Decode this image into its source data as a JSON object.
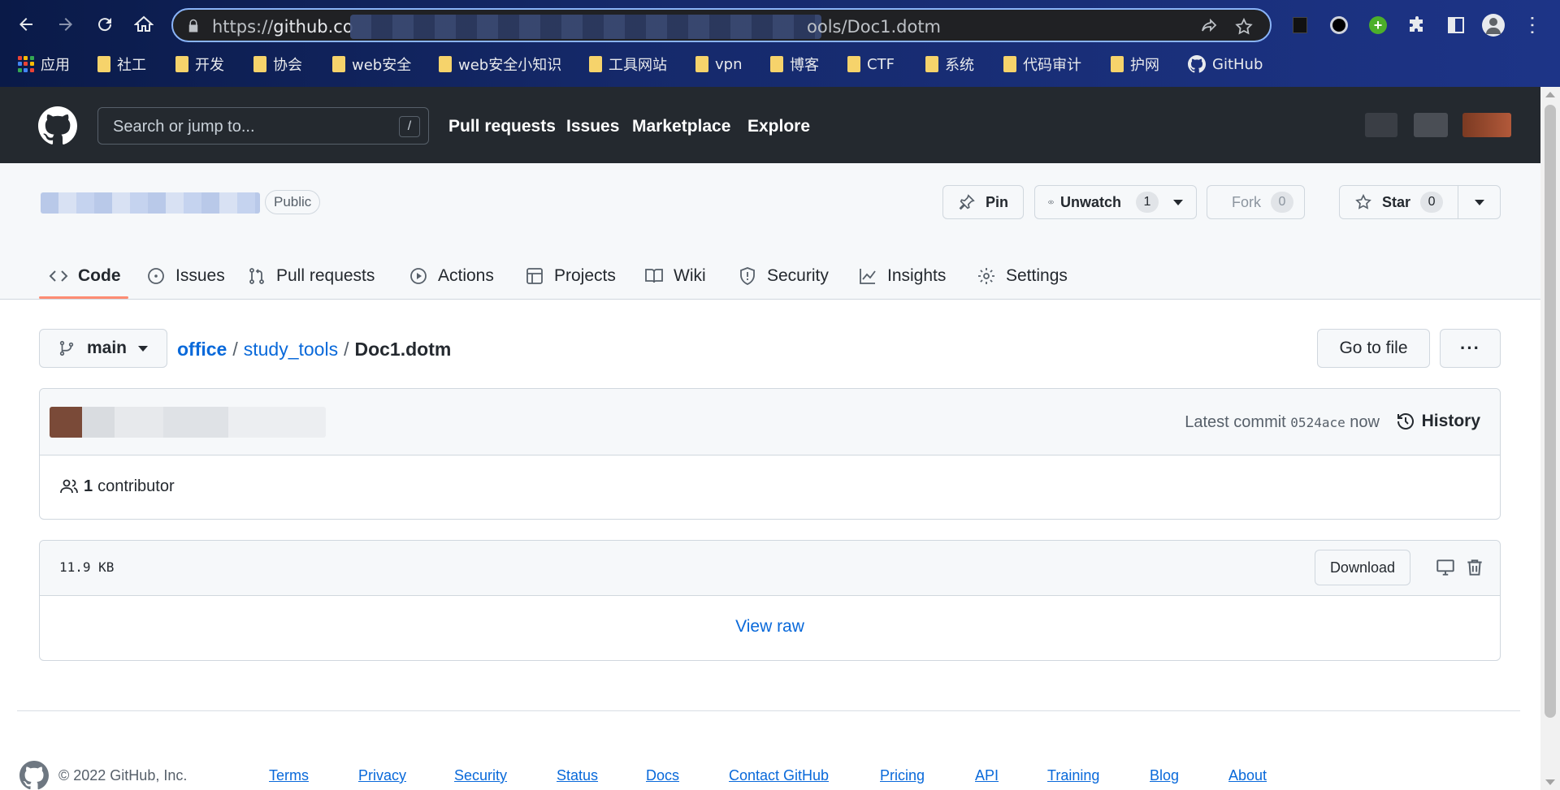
{
  "browser": {
    "url_prefix": "https://",
    "url_host": "github.co",
    "url_tail": "ools/Doc1.dotm",
    "bookmarks": [
      "应用",
      "社工",
      "开发",
      "协会",
      "web安全",
      "web安全小知识",
      "工具网站",
      "vpn",
      "博客",
      "CTF",
      "系统",
      "代码审计",
      "护网",
      "GitHub"
    ]
  },
  "header": {
    "search_placeholder": "Search or jump to...",
    "search_shortcut": "/",
    "nav": [
      "Pull requests",
      "Issues",
      "Marketplace",
      "Explore"
    ]
  },
  "repo": {
    "visibility": "Public",
    "pin_label": "Pin",
    "unwatch_label": "Unwatch",
    "watch_count": "1",
    "fork_label": "Fork",
    "fork_count": "0",
    "star_label": "Star",
    "star_count": "0",
    "tabs": [
      "Code",
      "Issues",
      "Pull requests",
      "Actions",
      "Projects",
      "Wiki",
      "Security",
      "Insights",
      "Settings"
    ]
  },
  "file": {
    "branch": "main",
    "path": [
      "office",
      "study_tools"
    ],
    "name": "Doc1.dotm",
    "goto_label": "Go to file",
    "more_label": "···",
    "latest_commit_label": "Latest commit",
    "commit_sha": "0524ace",
    "commit_time": "now",
    "history_label": "History",
    "contributors": "1",
    "contributor_label": "contributor",
    "size": "11.9 KB",
    "download_label": "Download",
    "view_raw_label": "View raw"
  },
  "footer": {
    "copyright": "© 2022 GitHub, Inc.",
    "links": [
      "Terms",
      "Privacy",
      "Security",
      "Status",
      "Docs",
      "Contact GitHub",
      "Pricing",
      "API",
      "Training",
      "Blog",
      "About"
    ]
  },
  "colors": {
    "header_bg": "#24292f",
    "link": "#0969da",
    "tab_underline": "#fd8c73",
    "chrome_bg": "#15296a"
  }
}
